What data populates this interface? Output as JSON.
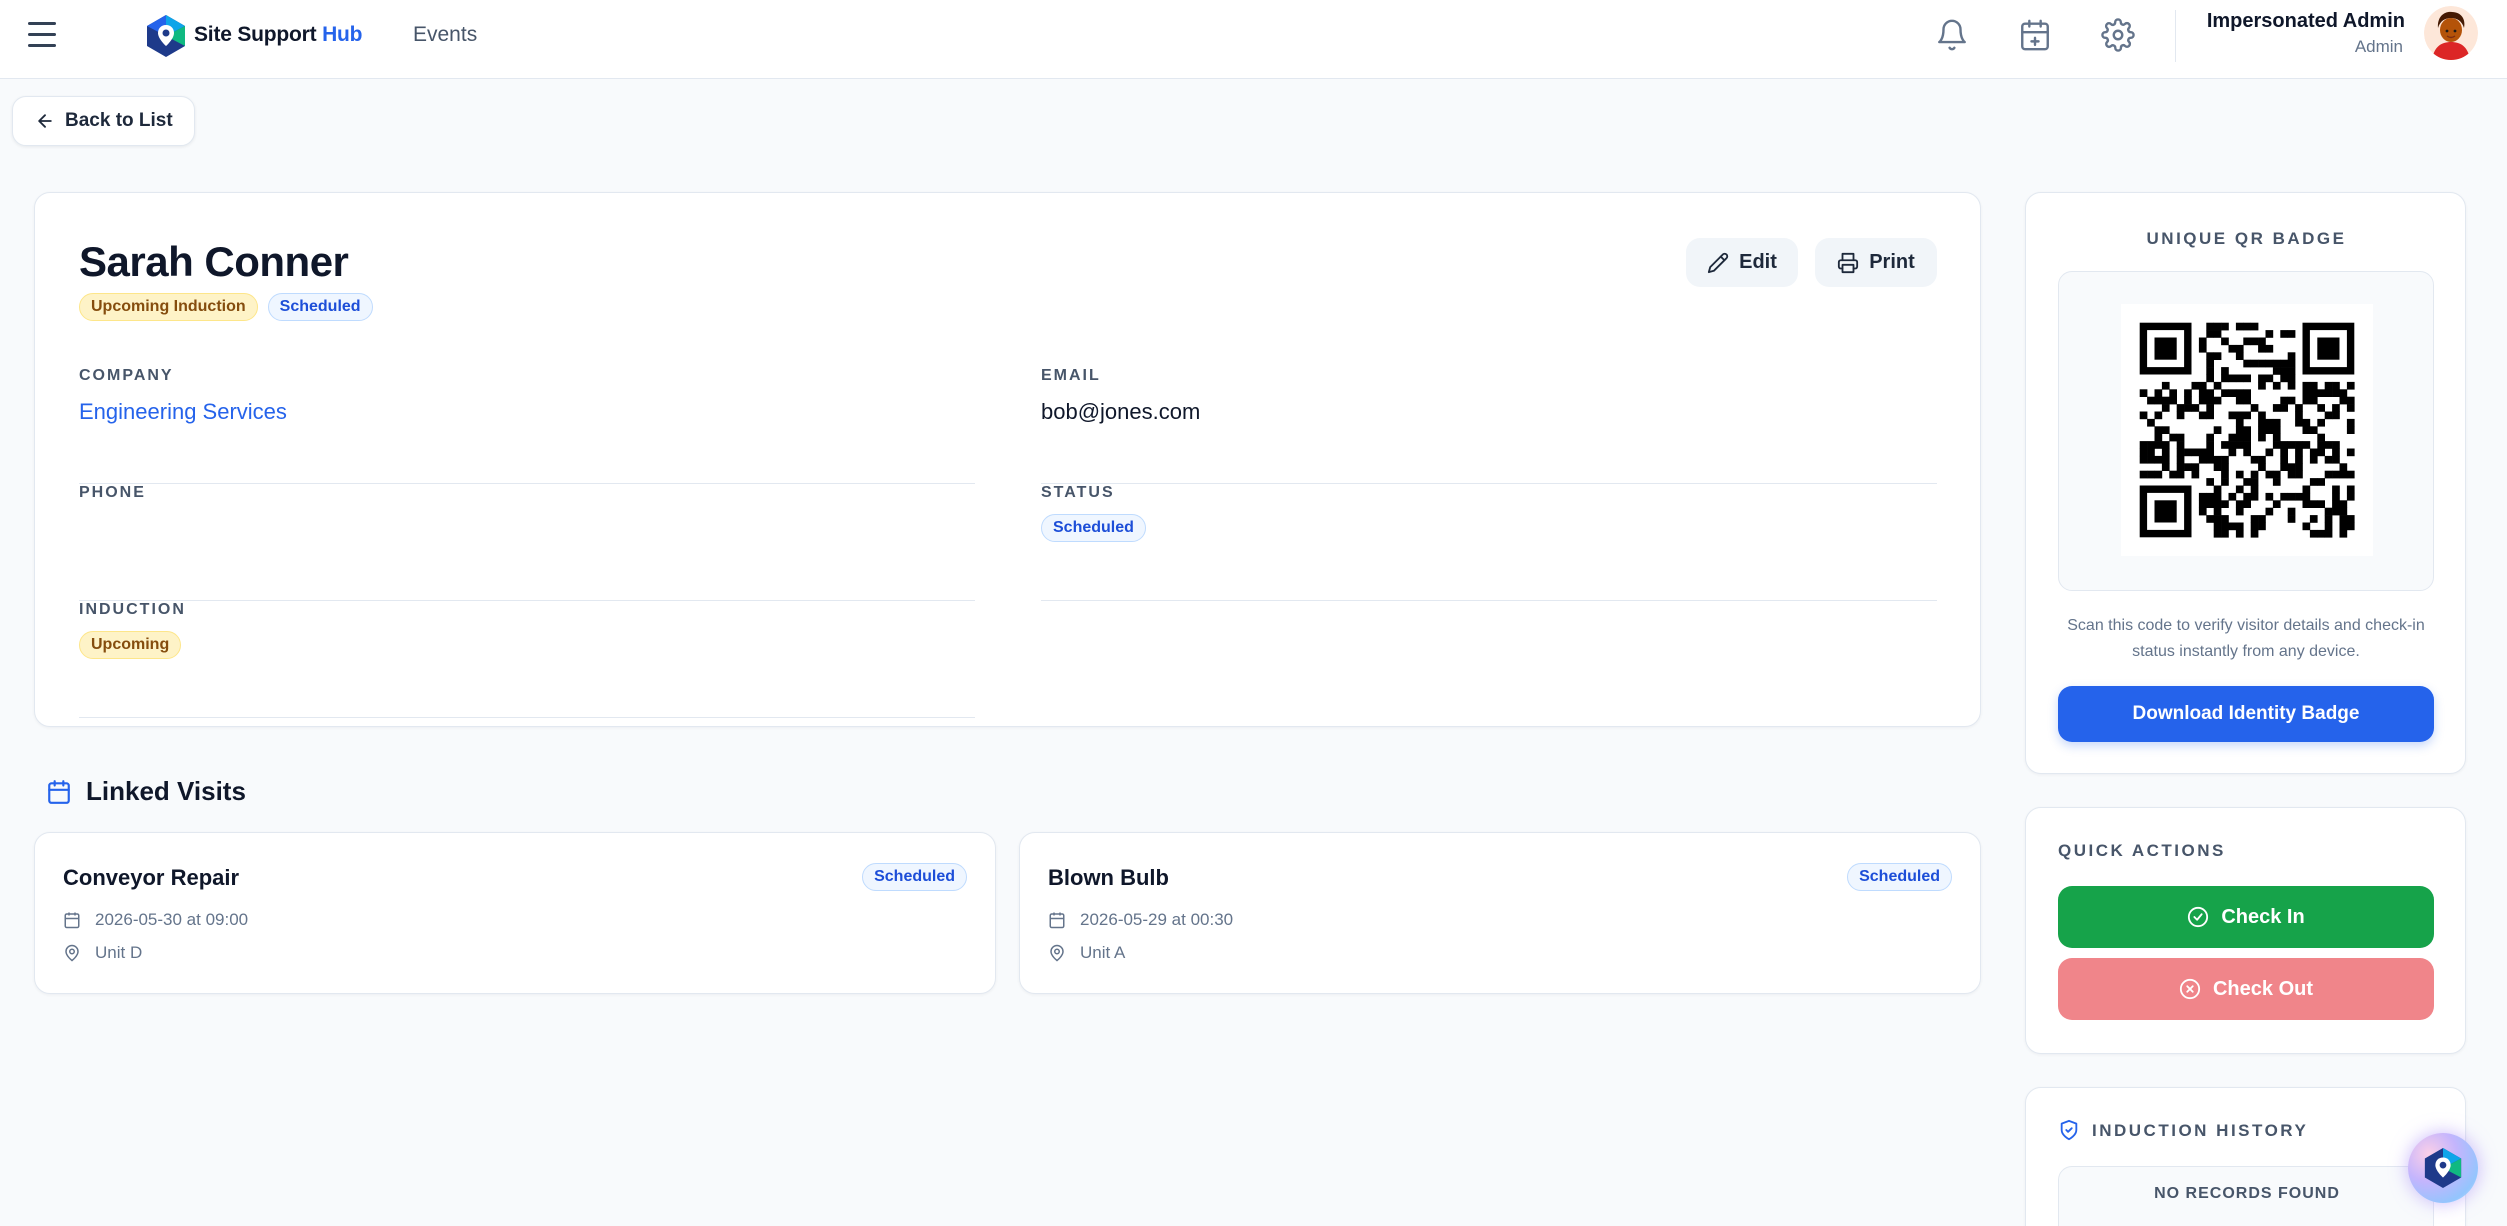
{
  "header": {
    "brand_main": "Site Support",
    "brand_accent": "Hub",
    "nav_events": "Events",
    "user_name": "Impersonated Admin",
    "user_role": "Admin",
    "icons": [
      "menu-icon",
      "bell-icon",
      "calendar-plus-icon",
      "gear-icon"
    ]
  },
  "back_label": "Back to List",
  "visitor": {
    "name": "Sarah Conner",
    "badges": [
      "Upcoming Induction",
      "Scheduled"
    ],
    "edit_label": "Edit",
    "print_label": "Print",
    "fields": {
      "company_label": "COMPANY",
      "company_value": "Engineering Services",
      "email_label": "EMAIL",
      "email_value": "bob@jones.com",
      "phone_label": "PHONE",
      "phone_value": "",
      "status_label": "STATUS",
      "status_value": "Scheduled",
      "induction_label": "INDUCTION",
      "induction_value": "Upcoming"
    }
  },
  "linked_visits": {
    "title": "Linked Visits",
    "items": [
      {
        "title": "Conveyor Repair",
        "status": "Scheduled",
        "datetime": "2026-05-30 at 09:00",
        "location": "Unit D"
      },
      {
        "title": "Blown Bulb",
        "status": "Scheduled",
        "datetime": "2026-05-29 at 00:30",
        "location": "Unit A"
      }
    ]
  },
  "qr": {
    "title": "UNIQUE QR BADGE",
    "description": "Scan this code to verify visitor details and check-in status instantly from any device.",
    "download_label": "Download Identity Badge"
  },
  "quick_actions": {
    "title": "QUICK ACTIONS",
    "check_in_label": "Check In",
    "check_out_label": "Check Out"
  },
  "induction_history": {
    "title": "INDUCTION HISTORY",
    "empty_label": "NO RECORDS FOUND"
  },
  "colors": {
    "accent": "#2563eb",
    "success": "#16a34a",
    "danger_muted": "#f0858a",
    "warning_bg": "#fef3c7"
  }
}
